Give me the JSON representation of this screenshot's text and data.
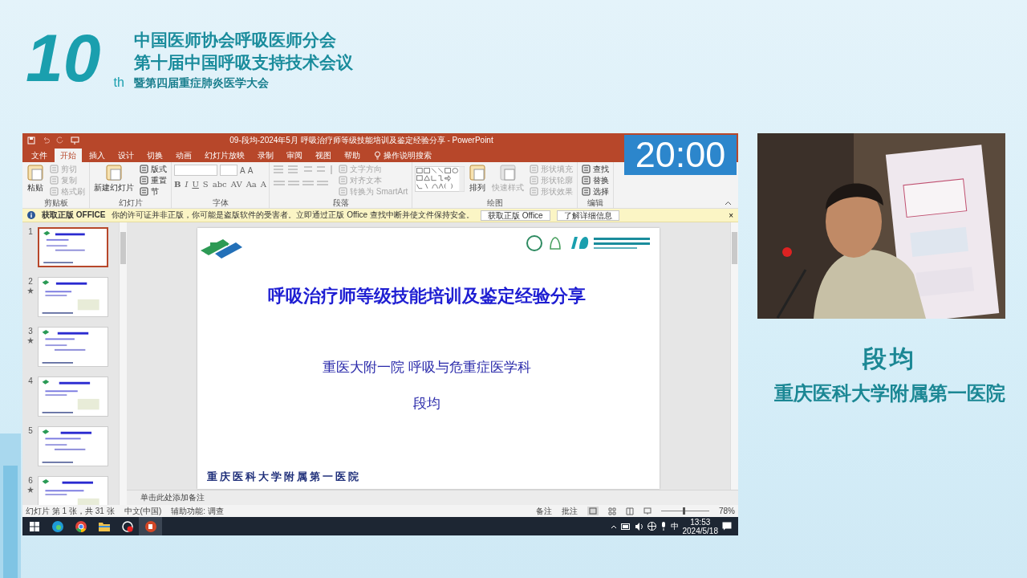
{
  "event_logo": {
    "number": "10",
    "suffix": "th",
    "lines": [
      "中国医师协会呼吸医师分会",
      "第十届中国呼吸支持技术会议",
      "暨第四届重症肺炎医学大会"
    ]
  },
  "powerpoint": {
    "title": "09-段均-2024年5月 呼吸治疗师等级技能培训及鉴定经验分享 - PowerPoint",
    "tabs": [
      {
        "label": "文件",
        "selected": false
      },
      {
        "label": "开始",
        "selected": true
      },
      {
        "label": "插入",
        "selected": false
      },
      {
        "label": "设计",
        "selected": false
      },
      {
        "label": "切换",
        "selected": false
      },
      {
        "label": "动画",
        "selected": false
      },
      {
        "label": "幻灯片放映",
        "selected": false
      },
      {
        "label": "录制",
        "selected": false
      },
      {
        "label": "审阅",
        "selected": false
      },
      {
        "label": "视图",
        "selected": false
      },
      {
        "label": "帮助",
        "selected": false
      }
    ],
    "search": "操作说明搜索",
    "ribbon_groups": [
      {
        "label": "剪贴板",
        "columns": [
          [
            {
              "kind": "large",
              "label": "粘贴",
              "disabled": false
            }
          ],
          [
            {
              "kind": "small",
              "label": "剪切",
              "disabled": true
            },
            {
              "kind": "small",
              "label": "复制",
              "disabled": true
            },
            {
              "kind": "small",
              "label": "格式刷",
              "disabled": true
            }
          ]
        ]
      },
      {
        "label": "幻灯片",
        "columns": [
          [
            {
              "kind": "large",
              "label": "新建幻灯片",
              "disabled": false
            }
          ],
          [
            {
              "kind": "small",
              "label": "版式",
              "disabled": false
            },
            {
              "kind": "small",
              "label": "重置",
              "disabled": false
            },
            {
              "kind": "small",
              "label": "节",
              "disabled": false
            }
          ]
        ]
      },
      {
        "label": "字体",
        "columns": [
          [
            {
              "kind": "font-fields",
              "glyphs": [
                "A",
                "A"
              ]
            },
            {
              "kind": "glyph-row",
              "glyphs": [
                "B",
                "I",
                "U",
                "S",
                "abc",
                "AV",
                "Aa",
                "A"
              ]
            }
          ]
        ]
      },
      {
        "label": "段落",
        "columns": [
          [
            {
              "kind": "list-tools"
            }
          ],
          [
            {
              "kind": "small",
              "label": "文字方向",
              "disabled": true
            },
            {
              "kind": "small",
              "label": "对齐文本",
              "disabled": true
            },
            {
              "kind": "small",
              "label": "转换为 SmartArt",
              "disabled": true
            }
          ]
        ]
      },
      {
        "label": "绘图",
        "columns": [
          [
            {
              "kind": "shape-gallery"
            }
          ],
          [
            {
              "kind": "large",
              "label": "排列",
              "disabled": false
            }
          ],
          [
            {
              "kind": "large",
              "label": "快速样式",
              "disabled": true
            }
          ],
          [
            {
              "kind": "small",
              "label": "形状填充",
              "disabled": true
            },
            {
              "kind": "small",
              "label": "形状轮廓",
              "disabled": true
            },
            {
              "kind": "small",
              "label": "形状效果",
              "disabled": true
            }
          ]
        ]
      },
      {
        "label": "编辑",
        "columns": [
          [
            {
              "kind": "small",
              "label": "查找",
              "disabled": false
            },
            {
              "kind": "small",
              "label": "替换",
              "disabled": false
            },
            {
              "kind": "small",
              "label": "选择",
              "disabled": false
            }
          ]
        ]
      }
    ],
    "notice": {
      "title": "获取正版 OFFICE",
      "message": "你的许可证并非正版，你可能是盗版软件的受害者。立即通过正版 Office 查找中断并使文件保持安全。",
      "buttons": [
        "获取正版 Office",
        "了解详细信息"
      ],
      "close": "×"
    },
    "thumbnails": [
      {
        "number": "1",
        "transition": false,
        "selected": true
      },
      {
        "number": "2",
        "transition": true,
        "selected": false
      },
      {
        "number": "3",
        "transition": true,
        "selected": false
      },
      {
        "number": "4",
        "transition": false,
        "selected": false
      },
      {
        "number": "5",
        "transition": false,
        "selected": false
      },
      {
        "number": "6",
        "transition": true,
        "selected": false
      }
    ],
    "slide": {
      "title": "呼吸治疗师等级技能培训及鉴定经验分享",
      "subtitle": "重医大附一院  呼吸与危重症医学科",
      "presenter": "段均",
      "footer": "重庆医科大学附属第一医院"
    },
    "notes_placeholder": "单击此处添加备注",
    "status_bar": {
      "slide_count": "幻灯片 第 1 张，共 31 张",
      "language": "中文(中国)",
      "accessibility": "辅助功能: 调查",
      "notes": "备注",
      "comments": "批注",
      "zoom_slider": {
        "level": 0.45
      },
      "zoom": "78%"
    },
    "taskbar": {
      "ime": "中",
      "time": "13:53",
      "date": "2024/5/18"
    }
  },
  "timer": "20:00",
  "speaker": {
    "name": "段均",
    "affiliation": "重庆医科大学附属第一医院"
  }
}
